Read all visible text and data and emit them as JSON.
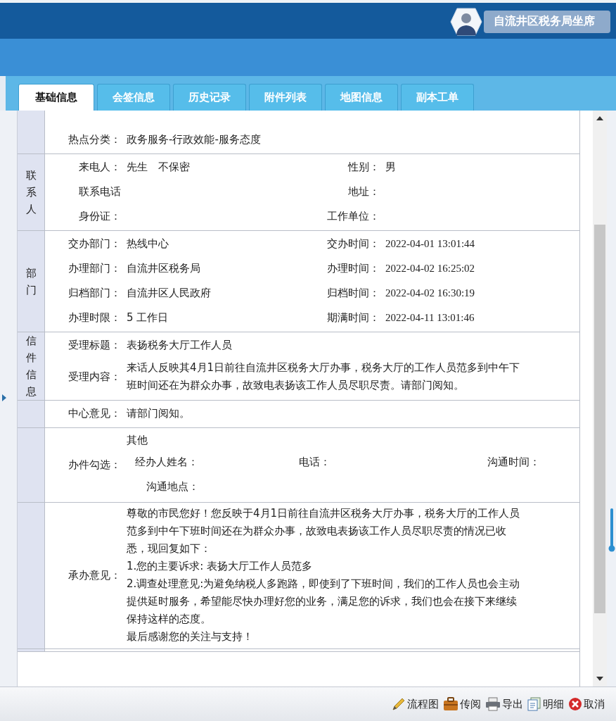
{
  "user": {
    "name": "自流井区税务局坐席"
  },
  "tabs": [
    {
      "label": "基础信息",
      "selected": true
    },
    {
      "label": "会签信息",
      "selected": false
    },
    {
      "label": "历史记录",
      "selected": false
    },
    {
      "label": "附件列表",
      "selected": false
    },
    {
      "label": "地图信息",
      "selected": false
    },
    {
      "label": "副本工单",
      "selected": false
    }
  ],
  "sections": [
    {
      "rows": [
        {
          "kind": "single",
          "label": "热点分类：",
          "value": "政务服务-行政效能-服务态度"
        }
      ]
    },
    {
      "label": "联系人",
      "rows": [
        {
          "kind": "pair",
          "label": "来电人：",
          "value": "先生　不保密",
          "label2": "性别：",
          "value2": "男"
        },
        {
          "kind": "pair",
          "label": "联系电话",
          "label2": "地址："
        },
        {
          "kind": "pair",
          "label": "身份证：",
          "label2": "工作单位："
        }
      ]
    },
    {
      "label": "部门",
      "rows": [
        {
          "kind": "pair",
          "label": "交办部门：",
          "value": "热线中心",
          "label2": "交办时间：",
          "value2": "2022-04-01 13:01:44"
        },
        {
          "kind": "pair",
          "label": "办理部门：",
          "value": "自流井区税务局",
          "label2": "办理时间：",
          "value2": "2022-04-02 16:25:02"
        },
        {
          "kind": "pair",
          "label": "归档部门：",
          "value": "自流井区人民政府",
          "label2": "归档时间：",
          "value2": "2022-04-02 16:30:19"
        },
        {
          "kind": "pair",
          "label": "办理时限：",
          "value": "5 工作日",
          "label2": "期满时间：",
          "value2": "2022-04-11 13:01:46"
        }
      ]
    },
    {
      "label": "信件信息",
      "rows": [
        {
          "kind": "single",
          "label": "受理标题：",
          "value": "表扬税务大厅工作人员"
        },
        {
          "kind": "text",
          "label": "受理内容：",
          "lines": [
            "来话人反映其4月1日前往自流井区税务大厅办事，税务大厅的工作人员范多到中午下",
            "班时间还在为群众办事，故致电表扬该工作人员尽职尽责。请部门阅知。"
          ]
        }
      ]
    },
    {
      "rows": [
        {
          "kind": "single",
          "label": "中心意见：",
          "value": "请部门阅知。"
        }
      ]
    },
    {
      "rows": [
        {
          "kind": "check",
          "label": "办件勾选：",
          "value": "其他",
          "fields": [
            "经办人姓名：",
            "电话：",
            "沟通时间：",
            "沟通地点："
          ]
        }
      ]
    },
    {
      "rows": [
        {
          "kind": "text",
          "label": "承办意见：",
          "lines": [
            "尊敬的市民您好！您反映于4月1日前往自流井区税务大厅办事，税务大厅的工作人员",
            "范多到中午下班时间还在为群众办事，故致电表扬该工作人员尽职尽责的情况已收",
            "悉，现回复如下：",
            "1.您的主要诉求: 表扬大厅工作人员范多",
            "2.调查处理意见:为避免纳税人多跑路，即使到了下班时间，我们的工作人员也会主动",
            "提供延时服务，希望能尽快办理好您的业务，满足您的诉求，我们也会在接下来继续",
            "保持这样的态度。",
            "最后感谢您的关注与支持！"
          ]
        }
      ]
    }
  ],
  "actions": [
    {
      "kind": "flow",
      "label": "流程图"
    },
    {
      "kind": "circulate",
      "label": "传阅"
    },
    {
      "kind": "export",
      "label": "导出"
    },
    {
      "kind": "detail",
      "label": "明细"
    },
    {
      "kind": "cancel",
      "label": "取消"
    }
  ]
}
